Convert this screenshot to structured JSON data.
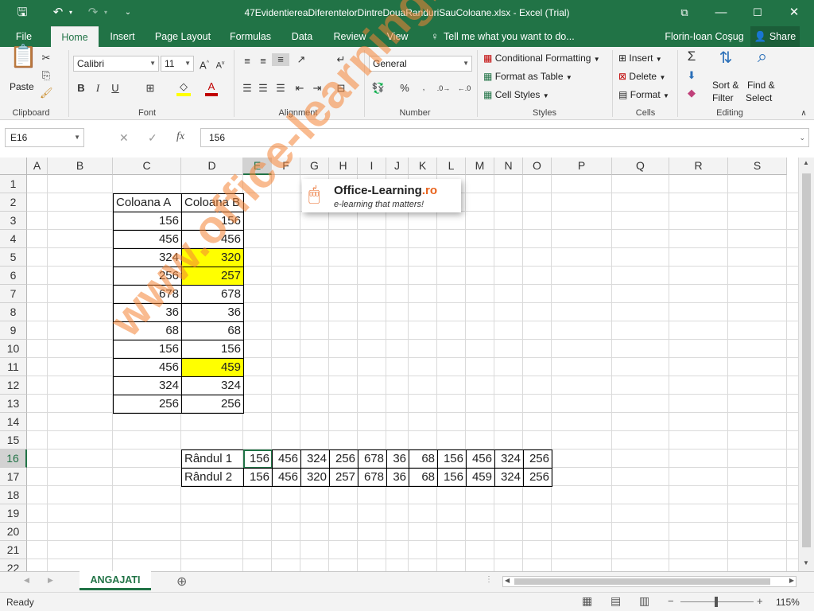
{
  "window": {
    "title": "47EvidentiereaDiferentelorDintreDouaRanduriSauColoane.xlsx - Excel (Trial)"
  },
  "tabs": [
    {
      "label": "File"
    },
    {
      "label": "Home"
    },
    {
      "label": "Insert"
    },
    {
      "label": "Page Layout"
    },
    {
      "label": "Formulas"
    },
    {
      "label": "Data"
    },
    {
      "label": "Review"
    },
    {
      "label": "View"
    }
  ],
  "tell_me": "Tell me what you want to do...",
  "user": "Florin-Ioan Coşug",
  "share": "Share",
  "ribbon": {
    "paste": "Paste",
    "font_name": "Calibri",
    "font_size": "11",
    "bold": "B",
    "italic": "I",
    "underline": "U",
    "number_format": "General",
    "percent": "%",
    "conditional_formatting": "Conditional Formatting",
    "format_as_table": "Format as Table",
    "cell_styles": "Cell Styles",
    "insert": "Insert",
    "delete": "Delete",
    "format": "Format",
    "sort_filter_1": "Sort &",
    "sort_filter_2": "Filter",
    "find_select_1": "Find &",
    "find_select_2": "Select",
    "groups": {
      "clipboard": "Clipboard",
      "font": "Font",
      "alignment": "Alignment",
      "number": "Number",
      "styles": "Styles",
      "cells": "Cells",
      "editing": "Editing"
    }
  },
  "formula_bar": {
    "name_box": "E16",
    "fx": "fx",
    "value": "156"
  },
  "columns": [
    "A",
    "B",
    "C",
    "D",
    "E",
    "F",
    "G",
    "H",
    "I",
    "J",
    "K",
    "L",
    "M",
    "N",
    "O",
    "P",
    "Q",
    "R",
    "S"
  ],
  "rows": [
    "1",
    "2",
    "3",
    "4",
    "5",
    "6",
    "7",
    "8",
    "9",
    "10",
    "11",
    "12",
    "13",
    "14",
    "15",
    "16",
    "17",
    "18",
    "19",
    "20",
    "21",
    "22"
  ],
  "table1": {
    "header_a": "Coloana A",
    "header_b": "Coloana B",
    "col_a": [
      "156",
      "456",
      "324",
      "256",
      "678",
      "36",
      "68",
      "156",
      "456",
      "324",
      "256"
    ],
    "col_b": [
      "156",
      "456",
      "320",
      "257",
      "678",
      "36",
      "68",
      "156",
      "459",
      "324",
      "256"
    ],
    "highlight_rows": [
      2,
      3,
      8
    ]
  },
  "table2": {
    "row1_label": "Rândul 1",
    "row2_label": "Rândul 2",
    "row1": [
      "156",
      "456",
      "324",
      "256",
      "678",
      "36",
      "68",
      "156",
      "456",
      "324",
      "256"
    ],
    "row2": [
      "156",
      "456",
      "320",
      "257",
      "678",
      "36",
      "68",
      "156",
      "459",
      "324",
      "256"
    ]
  },
  "watermark": "www.office-learning.ro",
  "logo": {
    "title": "Office-Learning",
    "suffix": ".ro",
    "tagline": "e-learning that matters!"
  },
  "sheet_tab": "ANGAJATI",
  "status": {
    "ready": "Ready",
    "zoom": "115%"
  },
  "colors": {
    "accent": "#217346",
    "highlight": "#ffff00",
    "watermark": "#f48334"
  }
}
